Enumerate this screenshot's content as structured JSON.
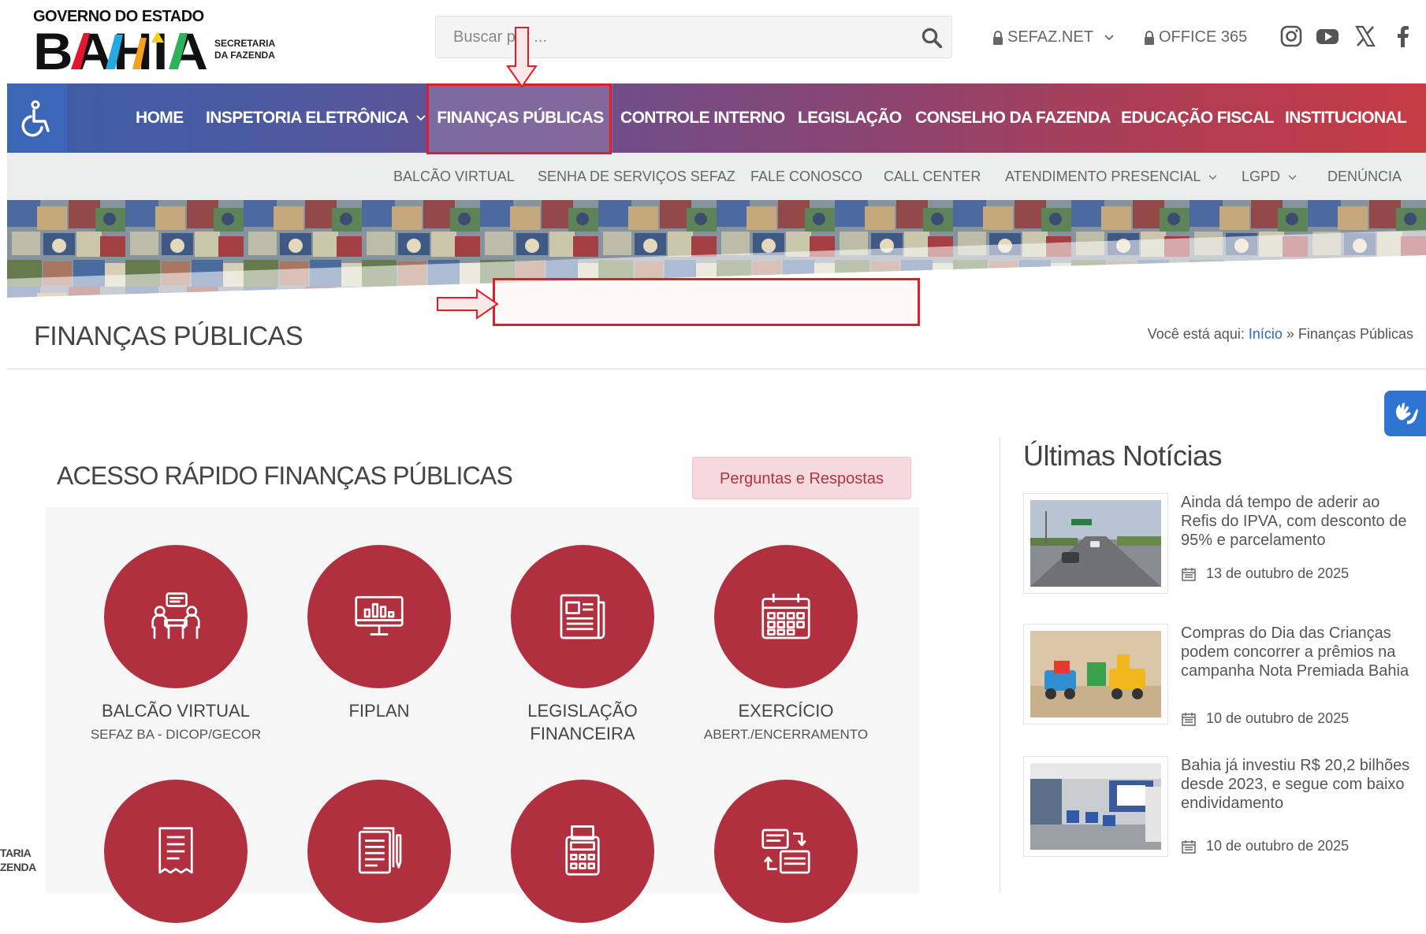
{
  "header": {
    "gov_line": "GOVERNO DO ESTADO",
    "state_name": "BAHIA",
    "secretaria_line1": "SECRETARIA",
    "secretaria_line2": "DA FAZENDA",
    "search_placeholder": "Buscar por ...",
    "links": [
      {
        "label": "SEFAZ.NET"
      },
      {
        "label": "OFFICE 365"
      }
    ],
    "social": [
      "instagram-icon",
      "youtube-icon",
      "x-twitter-icon",
      "facebook-icon"
    ]
  },
  "main_nav": [
    {
      "label": "HOME"
    },
    {
      "label": "INSPETORIA ELETRÔNICA"
    },
    {
      "label": "FINANÇAS PÚBLICAS",
      "active": true
    },
    {
      "label": "CONTROLE INTERNO"
    },
    {
      "label": "LEGISLAÇÃO"
    },
    {
      "label": "CONSELHO DA FAZENDA"
    },
    {
      "label": "EDUCAÇÃO FISCAL"
    },
    {
      "label": "INSTITUCIONAL"
    }
  ],
  "sub_nav": [
    {
      "label": "BALCÃO VIRTUAL"
    },
    {
      "label": "SENHA DE SERVIÇOS SEFAZ"
    },
    {
      "label": "FALE CONOSCO"
    },
    {
      "label": "CALL CENTER"
    },
    {
      "label": "ATENDIMENTO PRESENCIAL"
    },
    {
      "label": "LGPD"
    },
    {
      "label": "DENÚNCIA"
    }
  ],
  "page": {
    "title": "FINANÇAS PÚBLICAS",
    "breadcrumb_prefix": "Você está aqui:",
    "breadcrumb_home": "Início",
    "breadcrumb_sep": "»",
    "breadcrumb_current": "Finanças Públicas"
  },
  "quick_access": {
    "title": "ACESSO RÁPIDO FINANÇAS PÚBLICAS",
    "faq_button": "Perguntas e Respostas",
    "items": [
      {
        "label": "BALCÃO VIRTUAL",
        "sub": "SEFAZ BA - DICOP/GECOR",
        "icon": "meeting-icon"
      },
      {
        "label": "FIPLAN",
        "sub": "",
        "icon": "monitor-chart-icon"
      },
      {
        "label": "LEGISLAÇÃO FINANCEIRA",
        "sub": "",
        "icon": "newspaper-icon"
      },
      {
        "label": "EXERCÍCIO",
        "sub": "ABERT./ENCERRAMENTO",
        "icon": "calendar-icon"
      },
      {
        "label": "",
        "sub": "",
        "icon": "receipt-icon"
      },
      {
        "label": "",
        "sub": "",
        "icon": "document-pen-icon"
      },
      {
        "label": "",
        "sub": "",
        "icon": "calculator-icon"
      },
      {
        "label": "",
        "sub": "",
        "icon": "transfer-docs-icon"
      }
    ]
  },
  "news": {
    "title": "Últimas Notícias",
    "items": [
      {
        "title": "Ainda dá tempo de aderir ao Refis do IPVA, com desconto de 95% e parcelamento",
        "date": "13 de outubro de 2025"
      },
      {
        "title": "Compras do Dia das Crianças podem concorrer a prêmios na campanha Nota Premiada Bahia",
        "date": "10 de outubro de 2025"
      },
      {
        "title": "Bahia já investiu R$ 20,2 bilhões desde 2023, e segue com baixo endividamento",
        "date": "10 de outubro de 2025"
      }
    ]
  },
  "footer_fragment": {
    "line1": "TARIA",
    "line2": "ZENDA"
  },
  "colors": {
    "accent_red": "#b0303f",
    "annotation_red": "#e21d2b",
    "link_blue": "#2a6cb8"
  }
}
